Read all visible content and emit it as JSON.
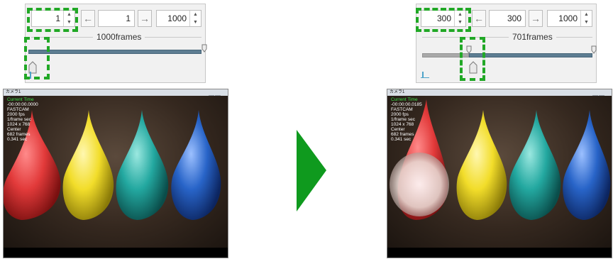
{
  "left_controls": {
    "current_frame": "1",
    "goto_frame": "1",
    "total_frame": "1000",
    "frames_label": "1000frames",
    "back_icon": "←",
    "forward_icon": "→",
    "slider_position_fraction": 0.0
  },
  "right_controls": {
    "current_frame": "300",
    "goto_frame": "300",
    "total_frame": "1000",
    "frames_label": "701frames",
    "back_icon": "←",
    "forward_icon": "→",
    "slider_position_fraction": 0.3
  },
  "left_video": {
    "window_title": "カメラ1",
    "info_lines": [
      "Current  Time",
      "-00:00:00.0000",
      "",
      "FASTCAM",
      "2000 fps",
      "1/frame sec",
      "1024 x 768",
      "Center",
      "682 frames",
      "0.341 sec"
    ]
  },
  "right_video": {
    "window_title": "カメラ1",
    "info_lines": [
      "Current  Time",
      "-00:00:00.0185",
      "",
      "FASTCAM",
      "2000 fps",
      "1/frame sec",
      "1024 x 768",
      "Center",
      "682 frames",
      "0.341 sec"
    ]
  },
  "colors": {
    "highlight": "#21a826",
    "balloon_red": "#e23a3a",
    "balloon_yellow": "#f2dd2a",
    "balloon_teal": "#23a8a0",
    "balloon_blue": "#2864c8",
    "play_arrow": "#0f9a1e"
  }
}
